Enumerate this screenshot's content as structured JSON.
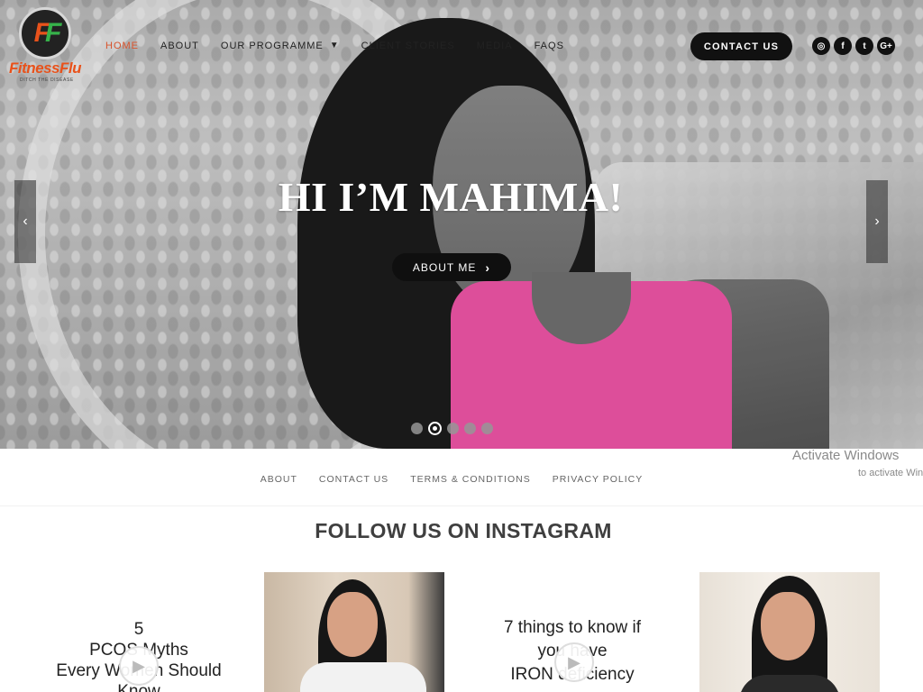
{
  "brand": {
    "logo_text_1": "Fitness",
    "logo_text_2": "Flu",
    "logo_mark": "FF",
    "tagline": "DITCH THE DISEASE"
  },
  "nav": {
    "items": [
      {
        "label": "HOME",
        "active": true
      },
      {
        "label": "ABOUT"
      },
      {
        "label": "OUR PROGRAMME",
        "has_dropdown": true
      },
      {
        "label": "CLIENT STORIES"
      },
      {
        "label": "MEDIA"
      },
      {
        "label": "FAQS"
      }
    ],
    "contact_label": "CONTACT US"
  },
  "social": [
    {
      "icon": "instagram-icon",
      "glyph": "◎"
    },
    {
      "icon": "facebook-icon",
      "glyph": "f"
    },
    {
      "icon": "twitter-icon",
      "glyph": "t"
    },
    {
      "icon": "google-plus-icon",
      "glyph": "G+"
    }
  ],
  "hero": {
    "title": "HI I’M MAHIMA!",
    "button_label": "ABOUT ME",
    "prev_glyph": "‹",
    "next_glyph": "›",
    "slides": 5,
    "active_slide": 2
  },
  "footer": {
    "links": [
      "ABOUT",
      "CONTACT US",
      "TERMS & CONDITIONS",
      "PRIVACY POLICY"
    ]
  },
  "watermark": {
    "line1": "Activate Windows",
    "line2": "to activate Win"
  },
  "instagram": {
    "title": "FOLLOW US ON INSTAGRAM",
    "posts": [
      {
        "type": "text",
        "lines": [
          "5",
          "PCOS Myths",
          "Every Women Should",
          "Know"
        ]
      },
      {
        "type": "photo"
      },
      {
        "type": "text",
        "lines": [
          "7 things to know if",
          "you have",
          "IRON deficiency"
        ]
      },
      {
        "type": "photo"
      }
    ]
  },
  "colors": {
    "accent": "#d8532c",
    "dark": "#111111",
    "pink": "#f055a8"
  }
}
